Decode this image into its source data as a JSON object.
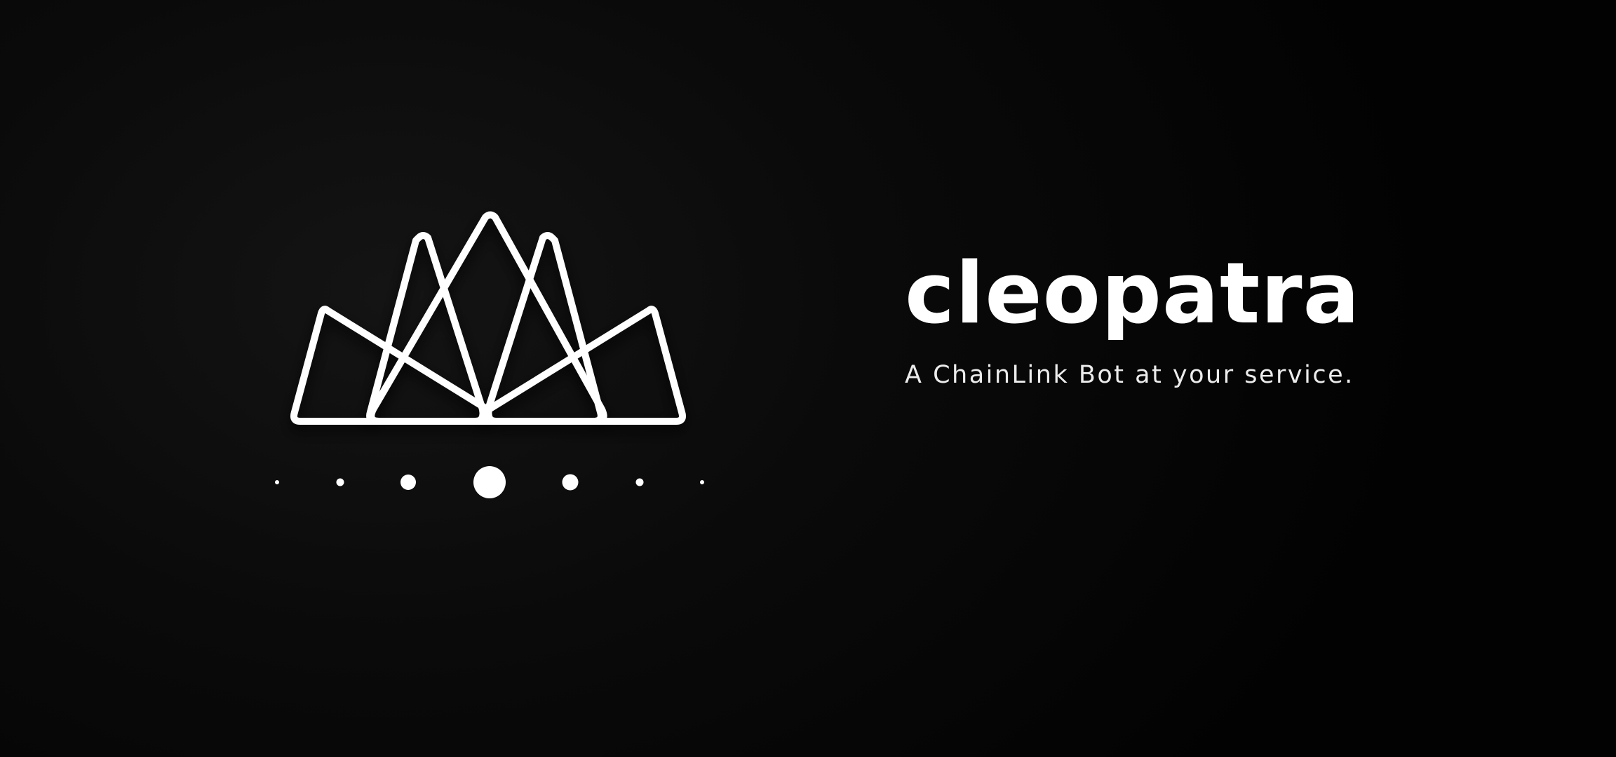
{
  "brand": {
    "name": "cleopatra",
    "tagline": "A ChainLink Bot at your service."
  },
  "logo": {
    "icon": "crown-mountains-logo-icon",
    "stroke_color": "#ffffff"
  },
  "loader": {
    "icon": "loading-dots-icon",
    "dot_count": 7,
    "active_index": 3
  },
  "colors": {
    "background": "#0b0b0b",
    "foreground": "#ffffff"
  }
}
